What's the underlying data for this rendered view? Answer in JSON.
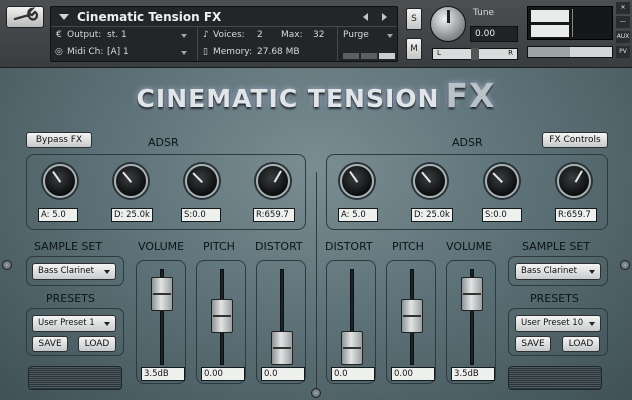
{
  "header": {
    "instrument_title": "Cinematic Tension FX",
    "output_label": "Output:",
    "output_value": "st. 1",
    "midi_label": "Midi Ch:",
    "midi_value": "[A] 1",
    "voices_label": "Voices:",
    "voices_value": "2",
    "max_label": "Max:",
    "max_value": "32",
    "memory_label": "Memory:",
    "memory_value": "27.68 MB",
    "purge_label": "Purge",
    "solo_label": "S",
    "mute_label": "M",
    "tune_label": "Tune",
    "tune_value": "0.00",
    "pan_left": "L",
    "pan_right": "R",
    "aux_label": "AUX",
    "pv_label": "PV",
    "volume_level": 0.5
  },
  "logo": {
    "main": "CINEMATIC TENSION",
    "fx": "FX"
  },
  "left": {
    "bypass_label": "Bypass FX",
    "adsr_title": "ADSR",
    "adsr": [
      {
        "label": "A: 5.0",
        "angle": -35
      },
      {
        "label": "D: 25.0k",
        "angle": -40
      },
      {
        "label": "S:0.0",
        "angle": -45
      },
      {
        "label": "R:659.7",
        "angle": 30
      }
    ],
    "sample_set_title": "SAMPLE SET",
    "sample_set_value": "Bass Clarinet",
    "presets_title": "PRESETS",
    "preset_value": "User Preset 1",
    "save_label": "SAVE",
    "load_label": "LOAD",
    "faders": [
      {
        "title": "VOLUME",
        "value": "3.5dB",
        "level": 0.85
      },
      {
        "title": "PITCH",
        "value": "0.00",
        "level": 0.5
      },
      {
        "title": "DISTORT",
        "value": "0.0",
        "level": 0.0
      }
    ]
  },
  "right": {
    "fx_controls_label": "FX Controls",
    "adsr_title": "ADSR",
    "adsr": [
      {
        "label": "A: 5.0",
        "angle": -35
      },
      {
        "label": "D: 25.0k",
        "angle": -40
      },
      {
        "label": "S:0.0",
        "angle": -45
      },
      {
        "label": "R:659.7",
        "angle": 30
      }
    ],
    "sample_set_title": "SAMPLE SET",
    "sample_set_value": "Bass Clarinet",
    "presets_title": "PRESETS",
    "preset_value": "User Preset 10",
    "save_label": "SAVE",
    "load_label": "LOAD",
    "faders": [
      {
        "title": "DISTORT",
        "value": "0.0",
        "level": 0.0
      },
      {
        "title": "PITCH",
        "value": "0.00",
        "level": 0.5
      },
      {
        "title": "VOLUME",
        "value": "3.5dB",
        "level": 0.85
      }
    ]
  }
}
